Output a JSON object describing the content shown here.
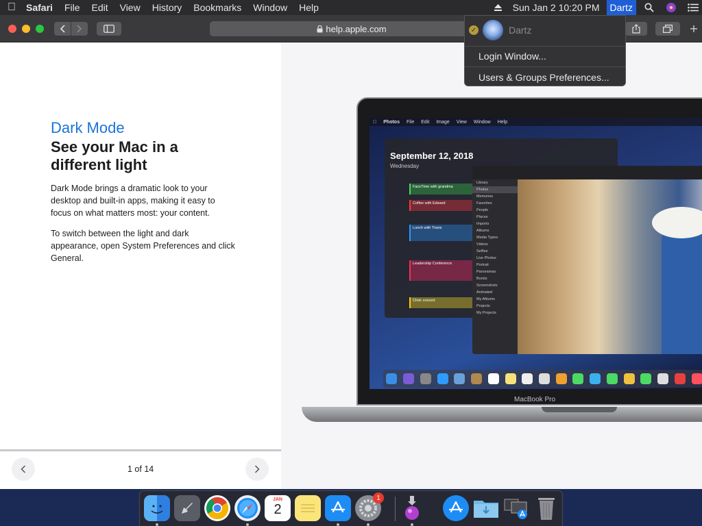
{
  "menubar": {
    "app_name": "Safari",
    "menus": [
      "File",
      "Edit",
      "View",
      "History",
      "Bookmarks",
      "Window",
      "Help"
    ],
    "clock": "Sun Jan 2  10:20 PM",
    "user": "Dartz"
  },
  "browser": {
    "url": "help.apple.com"
  },
  "user_menu": {
    "current_user": "Dartz",
    "items": [
      "Login Window...",
      "Users & Groups Preferences..."
    ]
  },
  "page": {
    "eyebrow": "Dark Mode",
    "headline": "See your Mac in a different light",
    "paragraphs": [
      "Dark Mode brings a dramatic look to your desktop and built-in apps, making it easy to focus on what matters most: your content.",
      "To switch between the light and dark appearance, open System Preferences and click General."
    ],
    "counter": "1 of 14",
    "laptop_label": "MacBook Pro",
    "inner_menu": [
      "Photos",
      "File",
      "Edit",
      "Image",
      "View",
      "Window",
      "Help"
    ],
    "inner_calendar_date": "September 12, 2018",
    "inner_calendar_weekday": "Wednesday",
    "inner_events": [
      "FaceTime with grandma",
      "Coffee with Edward",
      "Lunch with Travis",
      "Leadership Conference",
      "Choir concert"
    ],
    "inner_sidebar": [
      "Library",
      "Photos",
      "Memories",
      "Favorites",
      "People",
      "Places",
      "Imports",
      "Albums",
      "Media Types",
      "Videos",
      "Selfies",
      "Live Photos",
      "Portrait",
      "Panoramas",
      "Bursts",
      "Screenshots",
      "Animated",
      "My Albums",
      "Projects",
      "My Projects"
    ]
  },
  "dock": {
    "calendar_month": "JAN",
    "calendar_day": "2",
    "system_prefs_badge": "1"
  },
  "colors": {
    "accent_blue": "#1a73d9",
    "menu_highlight": "#1f5fd6"
  }
}
